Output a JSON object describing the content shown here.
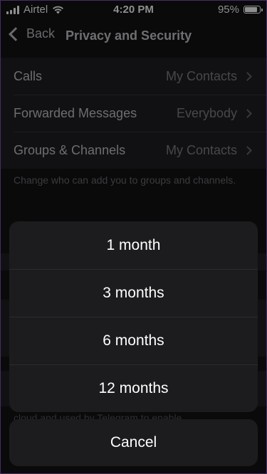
{
  "status_bar": {
    "carrier": "Airtel",
    "time": "4:20 PM",
    "battery_percent": "95%",
    "battery_level": 0.95,
    "icons": [
      "cellular-signal-icon",
      "wifi-icon",
      "battery-icon"
    ]
  },
  "nav": {
    "back_label": "Back",
    "title": "Privacy and Security"
  },
  "settings": {
    "rows": [
      {
        "label": "Calls",
        "value": "My Contacts"
      },
      {
        "label": "Forwarded Messages",
        "value": "Everybody"
      },
      {
        "label": "Groups & Channels",
        "value": "My Contacts"
      }
    ],
    "groups_footer": "Change who can add you to groups and channels.",
    "behind_text": "cloud and used by Telegram to enable"
  },
  "action_sheet": {
    "options": [
      "1 month",
      "3 months",
      "6 months",
      "12 months"
    ],
    "cancel_label": "Cancel"
  },
  "colors": {
    "sheet_background": "#1c1c1e",
    "sheet_text": "#ffffff",
    "dimmed_background": "#0a0a0b"
  }
}
